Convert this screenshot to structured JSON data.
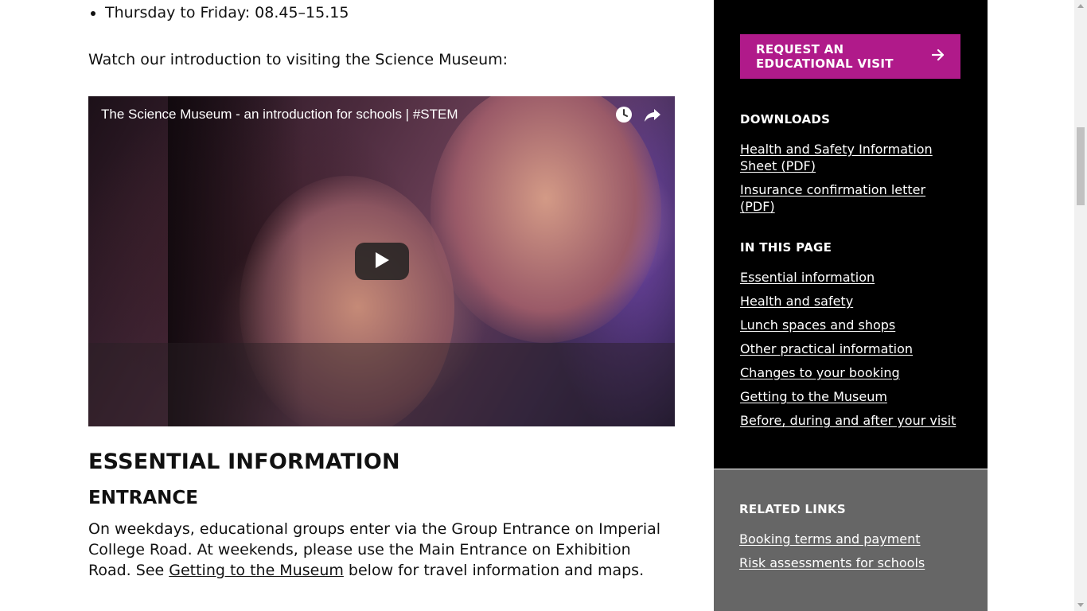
{
  "main": {
    "hours": [
      "Thursday to Friday: 08.45–15.15"
    ],
    "intro": "Watch our introduction to visiting the Science Museum:",
    "video": {
      "title": "The Science Museum - an introduction for schools | #STEM",
      "icons": [
        "watch-later-icon",
        "share-icon",
        "play-icon"
      ]
    },
    "essential_heading": "ESSENTIAL INFORMATION",
    "entrance_heading": "ENTRANCE",
    "entrance": {
      "before": "On weekdays, educational groups enter via the Group Entrance on Imperial College Road. At weekends, please use the Main Entrance on Exhibition Road. See ",
      "link": "Getting to the Museum",
      "after": " below for travel information and maps."
    }
  },
  "sidebar": {
    "cta_label": "REQUEST AN EDUCATIONAL VISIT",
    "cta_icon": "arrow-right-icon",
    "cta_color": "#b01a8a",
    "downloads_heading": "DOWNLOADS",
    "downloads": [
      "Health and Safety Information Sheet (PDF)",
      "Insurance confirmation letter (PDF)"
    ],
    "in_page_heading": "IN THIS PAGE",
    "in_page": [
      "Essential information",
      "Health and safety",
      "Lunch spaces and shops",
      "Other practical information",
      "Changes to your booking",
      "Getting to the Museum",
      "Before, during and after your visit"
    ],
    "related_heading": "RELATED LINKS",
    "related": [
      "Booking terms and payment",
      "Risk assessments for schools"
    ]
  }
}
